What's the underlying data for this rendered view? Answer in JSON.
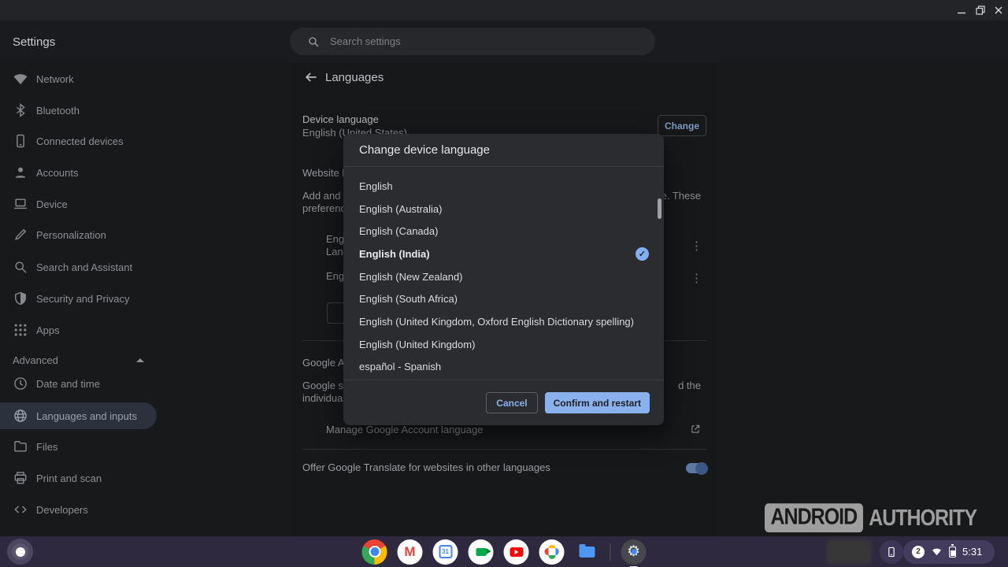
{
  "window_bar": {
    "controls": [
      "minimize",
      "restore",
      "close"
    ]
  },
  "header": {
    "app_title": "Settings",
    "search_placeholder": "Search settings"
  },
  "sidebar": {
    "items": [
      {
        "label": "Network",
        "icon": "wifi"
      },
      {
        "label": "Bluetooth",
        "icon": "bluetooth"
      },
      {
        "label": "Connected devices",
        "icon": "phone"
      },
      {
        "label": "Accounts",
        "icon": "person"
      },
      {
        "label": "Device",
        "icon": "laptop"
      },
      {
        "label": "Personalization",
        "icon": "brush"
      },
      {
        "label": "Search and Assistant",
        "icon": "search"
      },
      {
        "label": "Security and Privacy",
        "icon": "shield"
      },
      {
        "label": "Apps",
        "icon": "apps-grid"
      }
    ],
    "advanced": {
      "label": "Advanced",
      "expanded": true
    },
    "advanced_items": [
      {
        "label": "Date and time",
        "icon": "clock"
      },
      {
        "label": "Languages and inputs",
        "icon": "globe",
        "selected": true
      },
      {
        "label": "Files",
        "icon": "folder"
      },
      {
        "label": "Print and scan",
        "icon": "printer"
      },
      {
        "label": "Developers",
        "icon": "code"
      }
    ]
  },
  "main": {
    "page_title": "Languages",
    "device_language_label": "Device language",
    "device_language_value": "English (United States)",
    "change_button": "Change",
    "fragments": {
      "website_heading": "Website lan",
      "para_left1": "Add and ra",
      "para_right1": "le. These",
      "para_left2": "preference",
      "row1_line1": "Engl",
      "row1_line2": "Lan",
      "row2_line1": "Engl",
      "google_heading": "Google Acc",
      "gpara_left1": "Google site",
      "gpara_right1": "d the",
      "gpara_left2": "individual p"
    },
    "manage_account_link": "Manage Google Account language",
    "translate_row": {
      "label": "Offer Google Translate for websites in other languages",
      "toggle_on": true
    }
  },
  "dialog": {
    "title": "Change device language",
    "options": [
      {
        "label": "English",
        "selected": false
      },
      {
        "label": "English (Australia)",
        "selected": false
      },
      {
        "label": "English (Canada)",
        "selected": false
      },
      {
        "label": "English (India)",
        "selected": true
      },
      {
        "label": "English (New Zealand)",
        "selected": false
      },
      {
        "label": "English (South Africa)",
        "selected": false
      },
      {
        "label": "English (United Kingdom, Oxford English Dictionary spelling)",
        "selected": false
      },
      {
        "label": "English (United Kingdom)",
        "selected": false
      },
      {
        "label": "español - Spanish",
        "selected": false
      }
    ],
    "cancel_button": "Cancel",
    "confirm_button": "Confirm and restart"
  },
  "taskbar": {
    "apps": [
      "chrome",
      "gmail",
      "calendar",
      "meet",
      "youtube",
      "photos",
      "files",
      "settings"
    ],
    "active_app": "settings",
    "status": {
      "notification_count": "2",
      "time": "5:31"
    }
  },
  "watermark": {
    "word1": "ANDROID",
    "word2": "AUTHORITY"
  },
  "colors": {
    "accent_blue": "#8ab4f8",
    "taskbar_purple": "#2f2940",
    "dialog_bg": "#2b2c30"
  }
}
